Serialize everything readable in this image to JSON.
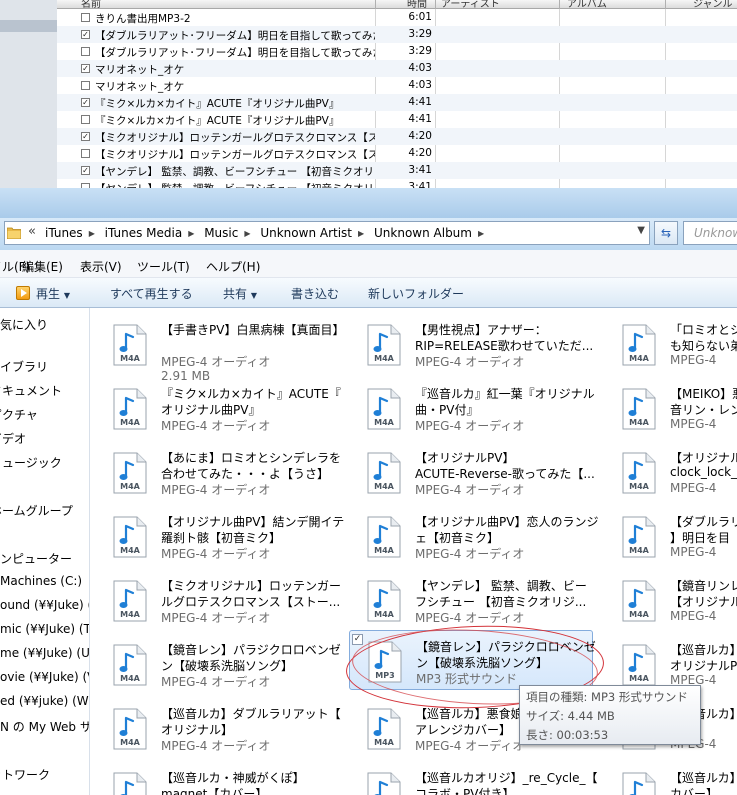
{
  "itunes": {
    "header": {
      "name": "名前",
      "time": "時間",
      "artist": "アーティスト",
      "album": "アルバム",
      "genre": "ジャンル"
    },
    "tracks": [
      {
        "checked": false,
        "name": "きりん書出用MP3-2",
        "time": "6:01"
      },
      {
        "checked": true,
        "name": "【ダブルラリアット･フリーダム】明日を目指して歌ってみた_b...",
        "time": "3:29"
      },
      {
        "checked": false,
        "name": "【ダブルラリアット･フリーダム】明日を目指して歌ってみた_b...",
        "time": "3:29"
      },
      {
        "checked": true,
        "name": "マリオネット_オケ",
        "time": "4:03"
      },
      {
        "checked": false,
        "name": "マリオネット_オケ",
        "time": "4:03"
      },
      {
        "checked": true,
        "name": "『ミク×ルカ×カイト』ACUTE『オリジナル曲PV』",
        "time": "4:41"
      },
      {
        "checked": false,
        "name": "『ミク×ルカ×カイト』ACUTE『オリジナル曲PV』",
        "time": "4:41"
      },
      {
        "checked": true,
        "name": "【ミクオリジナル】ロッテンガールグロテスクロマンス【ストーカー】",
        "time": "4:20"
      },
      {
        "checked": false,
        "name": "【ミクオリジナル】ロッテンガールグロテスクロマンス【ストーカー】",
        "time": "4:20"
      },
      {
        "checked": true,
        "name": "【ヤンデレ】 監禁、調教、ビーフシチュー 【初音ミクオリジ...",
        "time": "3:41"
      },
      {
        "checked": false,
        "name": "【ヤンデレ】 監禁、調教、ビーフシチュー 【初音ミクオリジ...",
        "time": "3:41"
      }
    ]
  },
  "explorer": {
    "address": {
      "chevron": "«",
      "crumbs": [
        "iTunes",
        "iTunes Media",
        "Music",
        "Unknown Artist",
        "Unknown Album"
      ],
      "search_placeholder": "Unknow"
    },
    "menu": [
      "ァイル(F)",
      "編集(E)",
      "表示(V)",
      "ツール(T)",
      "ヘルプ(H)"
    ],
    "toolbar": {
      "play": "再生",
      "play_all": "すべて再生する",
      "share": "共有",
      "burn": "書き込む",
      "new_folder": "新しいフォルダー"
    },
    "nav": [
      "お気に入り",
      "ライブラリ",
      "ドキュメント",
      "ピクチャ",
      "ビデオ",
      "ミュージック",
      "ホームグループ",
      "コンピューター",
      "Machines (C:)",
      "ound (¥¥Juke) (S",
      "mic (¥¥Juke) (T",
      "me (¥¥Juke) (U",
      "ovie (¥¥Juke) (V",
      "ed (¥¥juke) (W:",
      "N の My Web サ",
      "ットワーク"
    ],
    "files": {
      "icon_label": "M4A",
      "icon_label_mp3": "MP3",
      "col1": [
        {
          "t1": "【手書きPV】白黒病棟【真面目】",
          "t2": "",
          "type": "MPEG-4 オーディオ",
          "size": "2.91 MB"
        },
        {
          "t1": "『ミク×ルカ×カイト』ACUTE『",
          "t2": "オリジナル曲PV』",
          "type": "MPEG-4 オーディオ",
          "size": ""
        },
        {
          "t1": "【あにま】ロミオとシンデレラを",
          "t2": "合わせてみた・・・よ【うさ】",
          "type": "MPEG-4 オーディオ",
          "size": ""
        },
        {
          "t1": "【オリジナル曲PV】結ンデ開イテ",
          "t2": "羅刹ト骸【初音ミク】",
          "type": "MPEG-4 オーディオ",
          "size": ""
        },
        {
          "t1": "【ミクオリジナル】ロッテンガー",
          "t2": "ルグロテスクロマンス【ストー...",
          "type": "MPEG-4 オーディオ",
          "size": ""
        },
        {
          "t1": "【鏡音レン】パラジクロロベンゼ",
          "t2": "ン【破壊系洗脳ソング】",
          "type": "MPEG-4 オーディオ",
          "size": ""
        },
        {
          "t1": "【巡音ルカ】ダブルラリアット【",
          "t2": "オリジナル】",
          "type": "MPEG-4 オーディオ",
          "size": ""
        },
        {
          "t1": "【巡音ルカ・神威がくぽ】",
          "t2": "magnet【カバー】",
          "type": "",
          "size": ""
        }
      ],
      "col2": [
        {
          "t1": "【男性視点】アナザー：",
          "t2": "RIP=RELEASE歌わせていただ...",
          "type": "MPEG-4 オーディオ",
          "size": ""
        },
        {
          "t1": "『巡音ルカ』紅一葉『オリジナル",
          "t2": "曲・PV付』",
          "type": "MPEG-4 オーディオ",
          "size": ""
        },
        {
          "t1": "【オリジナルPV】",
          "t2": "ACUTE-Reverse-歌ってみた【...",
          "type": "MPEG-4 オーディオ",
          "size": ""
        },
        {
          "t1": "【オリジナル曲PV】恋人のランジ",
          "t2": "ェ【初音ミク】",
          "type": "MPEG-4 オーディオ",
          "size": ""
        },
        {
          "t1": "【ヤンデレ】 監禁、調教、ビー",
          "t2": "フシチュー 【初音ミクオリジ...",
          "type": "MPEG-4 オーディオ",
          "size": ""
        },
        {
          "t1": "【鏡音レン】パラジクロロベンゼ",
          "t2": "ン【破壊系洗脳ソング】",
          "type": "MP3 形式サウンド",
          "size": ""
        },
        {
          "t1": "【巡音ルカ】悪食娘コン",
          "t2": "アレンジカバー】",
          "type": "MPEG-4 オーディオ",
          "size": ""
        },
        {
          "t1": "【巡音ルカオリジ】_re_Cycle_【",
          "t2": "コラボ・PV付き】",
          "type": "",
          "size": ""
        }
      ],
      "col3": [
        {
          "t1": "「ロミオとシ",
          "t2": "も知らない弟",
          "type": "MPEG-4",
          "size": ""
        },
        {
          "t1": "【MEIKO】悪",
          "t2": "音リン・レン",
          "type": "MPEG-4",
          "size": ""
        },
        {
          "t1": "【オリジナル",
          "t2": "clock_lock_",
          "type": "MPEG-4",
          "size": ""
        },
        {
          "t1": "【ダブルラリ",
          "t2": "】明日を目",
          "type": "MPEG-4",
          "size": ""
        },
        {
          "t1": "【鏡音リンレ",
          "t2": "【オリジナル",
          "type": "MPEG-4",
          "size": ""
        },
        {
          "t1": "【巡音ルカ】",
          "t2": "オリジナルP",
          "type": "MPEG-4",
          "size": ""
        },
        {
          "t1": "【巡音ルカ】",
          "t2": "",
          "type": "MPEG-4",
          "size": ""
        },
        {
          "t1": "【巡音ルカ】",
          "t2": "カバー】",
          "type": "",
          "size": ""
        }
      ]
    },
    "tooltip": {
      "kind": "項目の種類: MP3 形式サウンド",
      "size": "サイズ: 4.44 MB",
      "length": "長さ: 00:03:53"
    }
  }
}
